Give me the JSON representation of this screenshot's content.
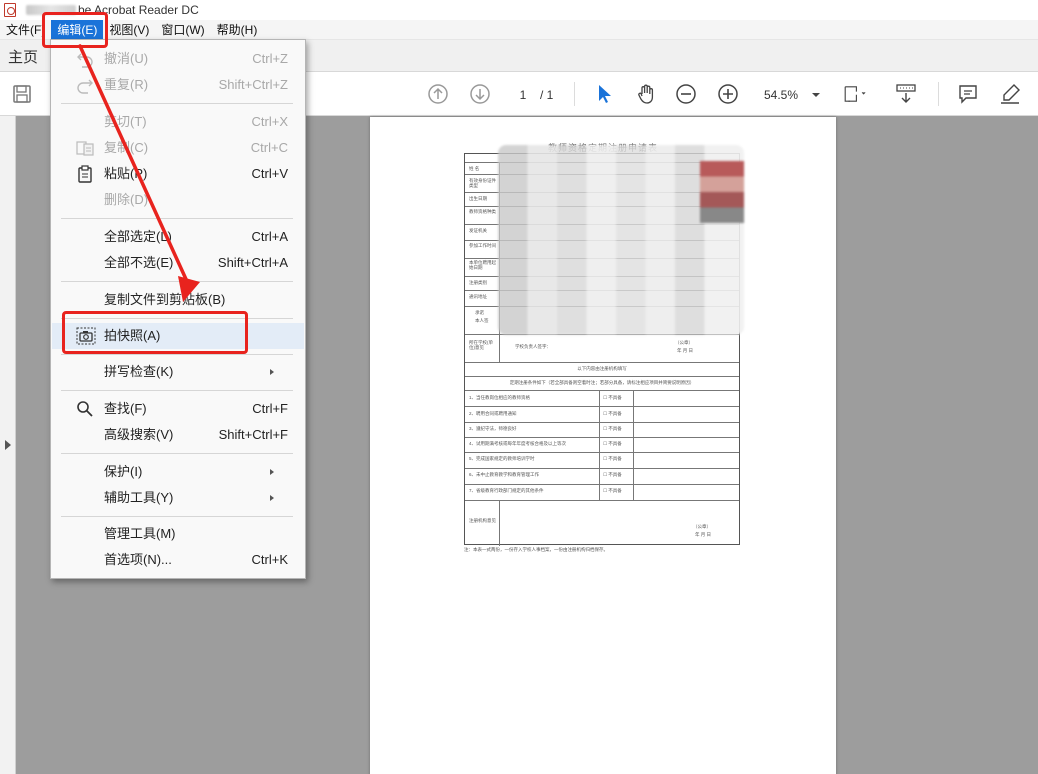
{
  "window": {
    "title": "be Acrobat Reader DC"
  },
  "menubar": {
    "items": [
      {
        "label": "文件(F)"
      },
      {
        "label": "编辑(E)",
        "active": true
      },
      {
        "label": "视图(V)"
      },
      {
        "label": "窗口(W)"
      },
      {
        "label": "帮助(H)"
      }
    ]
  },
  "tabs": {
    "home": "主页"
  },
  "toolbar": {
    "page_current": "1",
    "page_total": "/ 1",
    "zoom": "54.5%"
  },
  "edit_menu": {
    "items": [
      {
        "label": "撤消(U)",
        "shortcut": "Ctrl+Z",
        "disabled": true,
        "icon": "undo-icon"
      },
      {
        "label": "重复(R)",
        "shortcut": "Shift+Ctrl+Z",
        "disabled": true,
        "icon": "redo-icon"
      },
      {
        "label": "剪切(T)",
        "shortcut": "Ctrl+X",
        "disabled": true
      },
      {
        "label": "复制(C)",
        "shortcut": "Ctrl+C",
        "disabled": true,
        "icon": "copy-icon"
      },
      {
        "label": "粘贴(P)",
        "shortcut": "Ctrl+V",
        "disabled": false,
        "icon": "paste-icon"
      },
      {
        "label": "删除(D)",
        "shortcut": "",
        "disabled": true
      },
      {
        "label": "全部选定(L)",
        "shortcut": "Ctrl+A",
        "disabled": false
      },
      {
        "label": "全部不选(E)",
        "shortcut": "Shift+Ctrl+A",
        "disabled": false
      },
      {
        "label": "复制文件到剪贴板(B)",
        "shortcut": "",
        "disabled": false
      },
      {
        "label": "拍快照(A)",
        "shortcut": "",
        "disabled": false,
        "icon": "camera-icon",
        "highlighted": true
      },
      {
        "label": "拼写检查(K)",
        "shortcut": "",
        "disabled": false,
        "submenu": true
      },
      {
        "label": "查找(F)",
        "shortcut": "Ctrl+F",
        "disabled": false,
        "icon": "search-icon"
      },
      {
        "label": "高级搜索(V)",
        "shortcut": "Shift+Ctrl+F",
        "disabled": false
      },
      {
        "label": "保护(I)",
        "shortcut": "",
        "disabled": false,
        "submenu": true
      },
      {
        "label": "辅助工具(Y)",
        "shortcut": "",
        "disabled": false,
        "submenu": true
      },
      {
        "label": "管理工具(M)",
        "shortcut": "",
        "disabled": false
      },
      {
        "label": "首选项(N)...",
        "shortcut": "Ctrl+K",
        "disabled": false
      }
    ]
  },
  "document": {
    "title": "教师资格定期注册申请表",
    "section_header": "以下内容由注册机构填写",
    "conditions_intro": "定期注册条件如下（若全部具备则空着时注；若部分具备，请标注相应项目并简要说明原因）",
    "conditions": [
      {
        "text": "1、当任教岗位相应的教师资格",
        "status": "☐ 不具备"
      },
      {
        "text": "2、聘用合同或聘用通知",
        "status": "☐ 不具备"
      },
      {
        "text": "3、遵纪守法，师德良好",
        "status": "☐ 不具备"
      },
      {
        "text": "4、试用期满考核或每年年度考核合格及以上等次",
        "status": "☐ 不具备"
      },
      {
        "text": "5、完成国家规定的教师培训学时",
        "status": "☐ 不具备"
      },
      {
        "text": "6、未中止教育教学和教育管理工作",
        "status": "☐ 不具备"
      },
      {
        "text": "7、省级教育行政部门规定的其他条件",
        "status": "☐ 不具备"
      }
    ],
    "school_opinion_label": "所在学校(单位)意见",
    "school_signature": "学校负责人签字：",
    "seal_text": "（公章）",
    "date_text": "年  月  日",
    "registrar_opinion_label": "注册机构意见",
    "note": "注：本表一式两份，一份存入学校人事档案，一份由注册机构归档保存。",
    "left_labels": [
      "姓  名",
      "有效身份证件类型",
      "出生日期",
      "教师资格种类",
      "发证机关",
      "参加工作时间",
      "本单位聘用起始日期",
      "注册类别",
      "通讯地址",
      "承诺",
      "本人签"
    ]
  },
  "colors": {
    "menu_active": "#1a73d9",
    "annotation_red": "#e8231e",
    "menu_hover": "#e3ecf7"
  }
}
